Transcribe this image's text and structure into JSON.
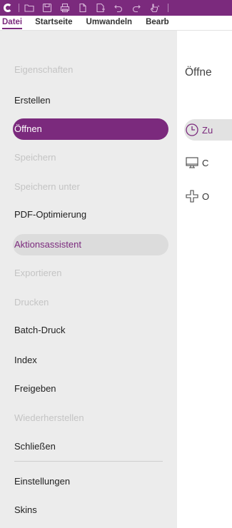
{
  "titlebar": {
    "icons": [
      "app-logo-icon",
      "open-folder-icon",
      "save-icon",
      "print-icon",
      "new-document-icon",
      "create-pdf-icon",
      "undo-icon",
      "redo-icon",
      "pointer-tool-icon"
    ]
  },
  "tabs": [
    "Datei",
    "Startseite",
    "Umwandeln",
    "Bearb"
  ],
  "sidebar": {
    "items": [
      {
        "label": "Eigenschaften",
        "state": "disabled"
      },
      {
        "label": "Erstellen",
        "state": "normal"
      },
      {
        "label": "Öffnen",
        "state": "active"
      },
      {
        "label": "Speichern",
        "state": "disabled"
      },
      {
        "label": "Speichern unter",
        "state": "disabled"
      },
      {
        "label": "PDF-Optimierung",
        "state": "normal"
      },
      {
        "label": "Aktionsassistent",
        "state": "hover"
      },
      {
        "label": "Exportieren",
        "state": "disabled"
      },
      {
        "label": "Drucken",
        "state": "disabled"
      },
      {
        "label": "Batch-Druck",
        "state": "normal"
      },
      {
        "label": "Index",
        "state": "normal"
      },
      {
        "label": "Freigeben",
        "state": "normal"
      },
      {
        "label": "Wiederherstellen",
        "state": "disabled"
      },
      {
        "label": "Schließen",
        "state": "normal"
      },
      {
        "label": "Einstellungen",
        "state": "normal"
      },
      {
        "label": "Skins",
        "state": "normal"
      }
    ]
  },
  "main": {
    "title": "Öffne",
    "options": [
      {
        "label": "Zu",
        "icon": "clock-icon"
      },
      {
        "label": "C",
        "icon": "computer-icon"
      },
      {
        "label": "O",
        "icon": "add-place-icon"
      }
    ]
  },
  "colors": {
    "accent": "#7b2a7d",
    "sidebar_bg": "#ececec",
    "disabled_text": "#c4c4c4"
  }
}
